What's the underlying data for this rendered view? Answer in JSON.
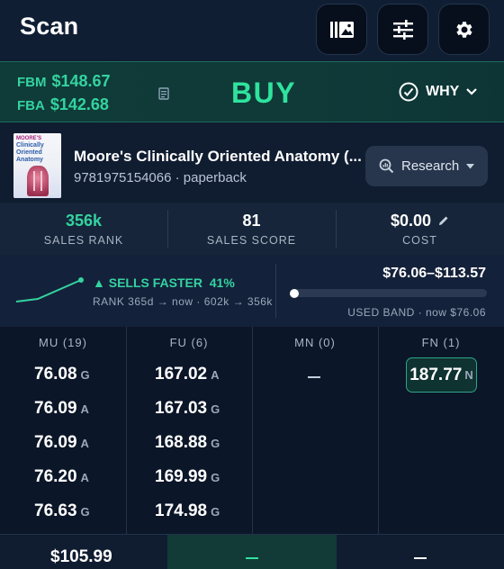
{
  "header": {
    "title": "Scan",
    "buttons": [
      {
        "name": "library-icon"
      },
      {
        "name": "sliders-icon"
      },
      {
        "name": "gear-icon"
      }
    ]
  },
  "pricing": {
    "fbm_label": "FBM",
    "fbm_price": "$148.67",
    "fba_label": "FBA",
    "fba_price": "$142.68",
    "decision": "BUY",
    "why_label": "WHY"
  },
  "product": {
    "title": "Moore's Clinically Oriented Anatomy (...",
    "isbn_format": "9781975154066 · paperback",
    "research_label": "Research",
    "cover_text": [
      "MOORE'S",
      "Clinically",
      "Oriented",
      "Anatomy"
    ]
  },
  "stats": {
    "sales_rank_value": "356k",
    "sales_rank_label": "SALES RANK",
    "sales_score_value": "81",
    "sales_score_label": "SALES SCORE",
    "cost_value": "$0.00",
    "cost_label": "COST"
  },
  "trend": {
    "sells_text": "▲ SELLS FASTER",
    "sells_pct": "41%",
    "rank_text": "RANK 365d → now · 602k → 356k",
    "band_range": "$76.06–$113.57",
    "band_label": "USED BAND · now $76.06",
    "band_position": 0.0
  },
  "offers": {
    "columns": [
      {
        "header": "MU (19)",
        "rows": [
          {
            "price": "76.08",
            "cond": "G"
          },
          {
            "price": "76.09",
            "cond": "A"
          },
          {
            "price": "76.09",
            "cond": "A"
          },
          {
            "price": "76.20",
            "cond": "A"
          },
          {
            "price": "76.63",
            "cond": "G"
          }
        ]
      },
      {
        "header": "FU (6)",
        "rows": [
          {
            "price": "167.02",
            "cond": "A"
          },
          {
            "price": "167.03",
            "cond": "G"
          },
          {
            "price": "168.88",
            "cond": "G"
          },
          {
            "price": "169.99",
            "cond": "G"
          },
          {
            "price": "174.98",
            "cond": "G"
          }
        ]
      },
      {
        "header": "MN (0)",
        "empty": "—"
      },
      {
        "header": "FN (1)",
        "highlight": {
          "price": "187.77",
          "cond": "N"
        }
      }
    ]
  },
  "bottom": {
    "col1": "$105.99",
    "col2": "—",
    "col3": "—"
  },
  "colors": {
    "accent": "#2fe39d",
    "background": "#0d1b2e"
  }
}
